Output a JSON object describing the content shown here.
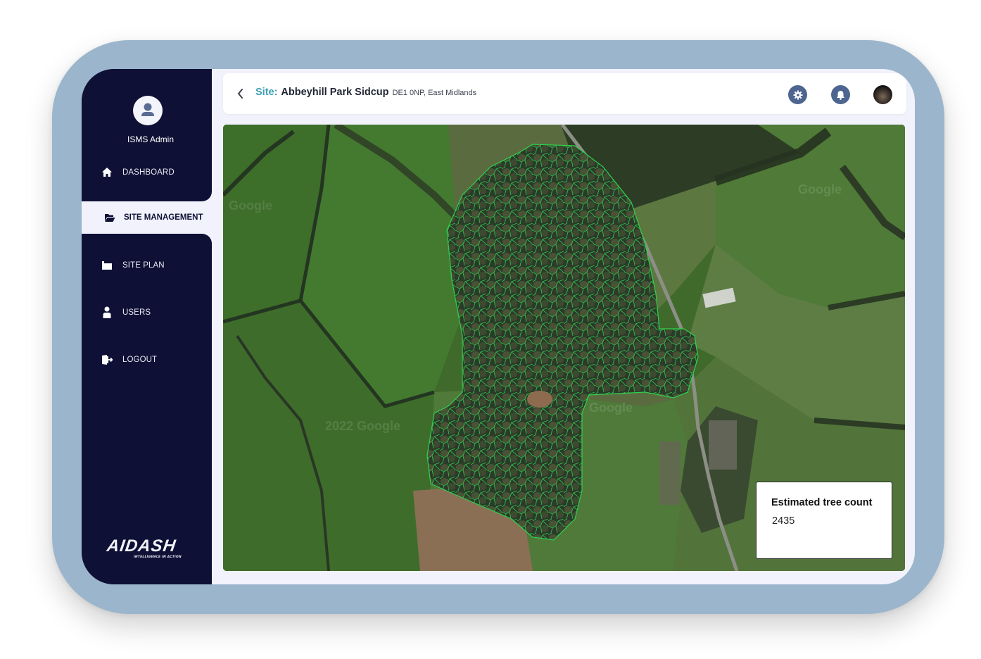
{
  "user": {
    "name": "ISMS Admin",
    "icon": "user-circle-icon"
  },
  "sidebar": {
    "items": [
      {
        "label": "DASHBOARD",
        "icon": "home-icon",
        "active": false
      },
      {
        "label": "SITE MANAGEMENT",
        "icon": "folder-open-icon",
        "active": true
      },
      {
        "label": "SITE PLAN",
        "icon": "site-plan-icon",
        "active": false
      },
      {
        "label": "USERS",
        "icon": "user-icon",
        "active": false
      },
      {
        "label": "LOGOUT",
        "icon": "logout-icon",
        "active": false
      }
    ]
  },
  "brand": {
    "name": "AIDASH",
    "tagline": "INTELLIGENCE IN ACTION"
  },
  "header": {
    "back_icon": "chevron-left-icon",
    "site_label": "Site:",
    "site_name": "Abbeyhill Park Sidcup",
    "site_address": "DE1 0NP, East Midlands",
    "icons": [
      "gear-icon",
      "bell-icon",
      "user-photo"
    ]
  },
  "map": {
    "watermarks": [
      "Google",
      "Google",
      "2022 Google",
      "Google"
    ],
    "overlay_color": "#2fd14d",
    "tree_count_card": {
      "title": "Estimated tree count",
      "value": "2435"
    }
  },
  "colors": {
    "sidebar_bg": "#0e1035",
    "frame": "#9bb5cc",
    "accent": "#3d9fb5",
    "icon_bg": "#4d6590"
  }
}
